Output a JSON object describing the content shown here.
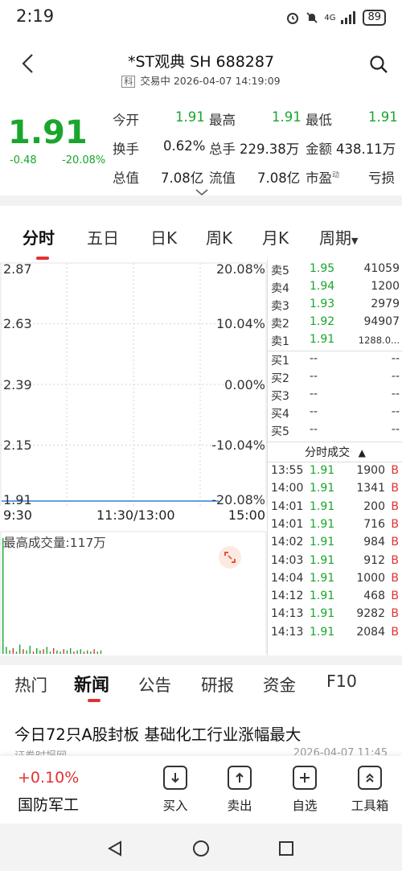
{
  "status": {
    "time": "2:19",
    "battery": "89",
    "net": "4G"
  },
  "header": {
    "title": "*ST观典 SH 688287",
    "badge": "科",
    "subtitle": "交易中 2026-04-07 14:19:09"
  },
  "quote": {
    "price": "1.91",
    "change": "-0.48",
    "change_pct": "-20.08%",
    "rows": [
      [
        {
          "label": "今开",
          "value": "1.91"
        },
        {
          "label": "最高",
          "value": "1.91"
        },
        {
          "label": "最低",
          "value": "1.91"
        }
      ],
      [
        {
          "label": "换手",
          "value": "0.62%"
        },
        {
          "label": "总手",
          "value": "229.38万"
        },
        {
          "label": "金额",
          "value": "438.11万"
        }
      ],
      [
        {
          "label": "总值",
          "value": "7.08亿"
        },
        {
          "label": "流值",
          "value": "7.08亿"
        },
        {
          "label": "市盈",
          "value": "亏损",
          "sup": "动"
        }
      ]
    ]
  },
  "chart_tabs": [
    "分时",
    "五日",
    "日K",
    "周K",
    "月K",
    "周期"
  ],
  "chart": {
    "y_left": [
      "2.87",
      "2.63",
      "2.39",
      "2.15",
      "1.91"
    ],
    "y_right": [
      "20.08%",
      "10.04%",
      "0.00%",
      "-10.04%",
      "-20.08%"
    ],
    "x_labels": [
      "9:30",
      "11:30/13:00",
      "15:00"
    ],
    "volume_label": "最高成交量:117万"
  },
  "chart_data": {
    "type": "line",
    "title": "",
    "xlabel": "",
    "ylabel": "",
    "x_ticks": [
      "9:30",
      "11:30/13:00",
      "15:00"
    ],
    "ylim": [
      1.91,
      2.87
    ],
    "y_ticks": [
      2.87,
      2.63,
      2.39,
      2.15,
      1.91
    ],
    "y2_ticks": [
      "20.08%",
      "10.04%",
      "0.00%",
      "-10.04%",
      "-20.08%"
    ],
    "series": [
      {
        "values": [
          1.91,
          1.91,
          1.91,
          1.91,
          1.91,
          1.91,
          1.91,
          1.91,
          1.91,
          1.91
        ]
      }
    ],
    "volume_max": "117万",
    "volume_relative": [
      1.0,
      0.06,
      0.03,
      0.05,
      0.02,
      0.08,
      0.04,
      0.03,
      0.07,
      0.02,
      0.05,
      0.03,
      0.04,
      0.06,
      0.02,
      0.05,
      0.03,
      0.02,
      0.04,
      0.03,
      0.05,
      0.02,
      0.03,
      0.04,
      0.02,
      0.03,
      0.02,
      0.04,
      0.02,
      0.03
    ]
  },
  "order_book": {
    "asks": [
      {
        "label": "卖5",
        "price": "1.95",
        "vol": "41059"
      },
      {
        "label": "卖4",
        "price": "1.94",
        "vol": "1200"
      },
      {
        "label": "卖3",
        "price": "1.93",
        "vol": "2979"
      },
      {
        "label": "卖2",
        "price": "1.92",
        "vol": "94907"
      },
      {
        "label": "卖1",
        "price": "1.91",
        "vol": "1288.0..."
      }
    ],
    "bids": [
      {
        "label": "买1",
        "price": "--",
        "vol": "--"
      },
      {
        "label": "买2",
        "price": "--",
        "vol": "--"
      },
      {
        "label": "买3",
        "price": "--",
        "vol": "--"
      },
      {
        "label": "买4",
        "price": "--",
        "vol": "--"
      },
      {
        "label": "买5",
        "price": "--",
        "vol": "--"
      }
    ]
  },
  "trades_title": "分时成交",
  "trades": [
    {
      "time": "13:55",
      "price": "1.91",
      "vol": "1900",
      "side": "B"
    },
    {
      "time": "14:00",
      "price": "1.91",
      "vol": "1341",
      "side": "B"
    },
    {
      "time": "14:01",
      "price": "1.91",
      "vol": "200",
      "side": "B"
    },
    {
      "time": "14:01",
      "price": "1.91",
      "vol": "716",
      "side": "B"
    },
    {
      "time": "14:02",
      "price": "1.91",
      "vol": "984",
      "side": "B"
    },
    {
      "time": "14:03",
      "price": "1.91",
      "vol": "912",
      "side": "B"
    },
    {
      "time": "14:04",
      "price": "1.91",
      "vol": "1000",
      "side": "B"
    },
    {
      "time": "14:12",
      "price": "1.91",
      "vol": "468",
      "side": "B"
    },
    {
      "time": "14:13",
      "price": "1.91",
      "vol": "9282",
      "side": "B"
    },
    {
      "time": "14:13",
      "price": "1.91",
      "vol": "2084",
      "side": "B"
    }
  ],
  "news_tabs": [
    "热门",
    "新闻",
    "公告",
    "研报",
    "资金",
    "F10"
  ],
  "news": {
    "headline": "今日72只A股封板 基础化工行业涨幅最大",
    "source": "证券时报网",
    "time": "2026-04-07 11:45"
  },
  "bottom": {
    "sector_change": "+0.10%",
    "sector_name": "国防军工",
    "actions": [
      {
        "label": "买入",
        "icon": "arrow-down-box-icon"
      },
      {
        "label": "卖出",
        "icon": "arrow-up-box-icon"
      },
      {
        "label": "自选",
        "icon": "plus-box-icon"
      },
      {
        "label": "工具箱",
        "icon": "double-chevron-box-icon"
      }
    ]
  },
  "colors": {
    "down": "#1aa52d",
    "up": "#e03232",
    "line": "#2f7fe0"
  }
}
